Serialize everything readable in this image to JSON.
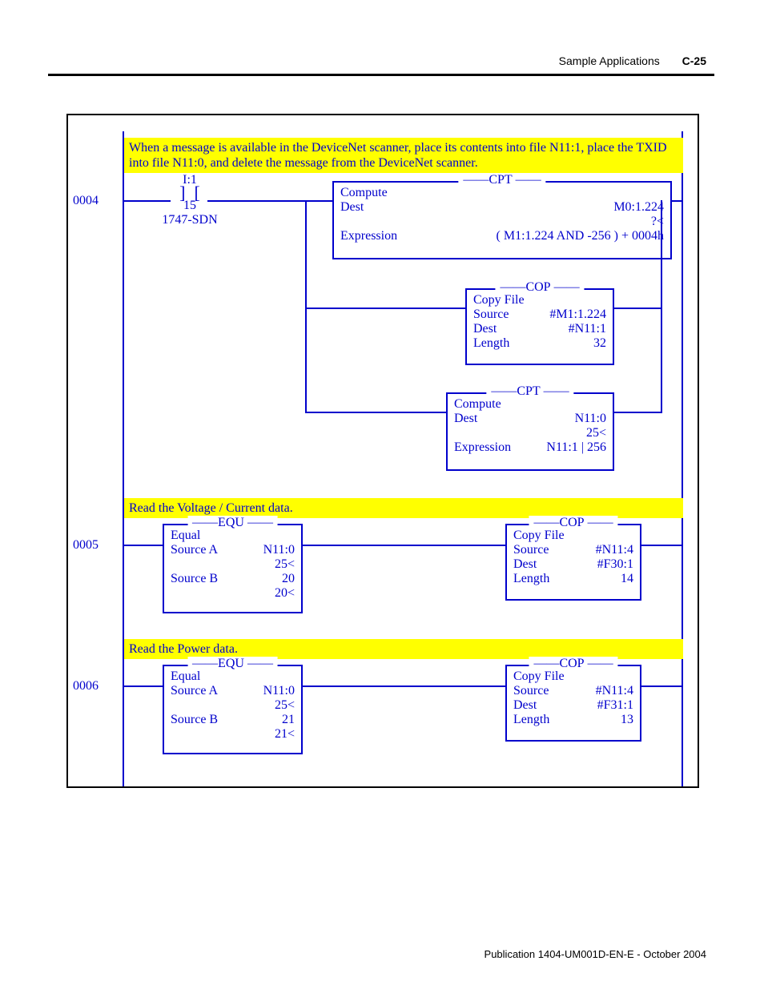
{
  "header": {
    "section": "Sample Applications",
    "pagenum": "C-25"
  },
  "footer": "Publication 1404-UM001D-EN-E - October 2004",
  "rung4": {
    "number": "0004",
    "comment": "When a message is available in the DeviceNet scanner, place its contents into file N11:1, place the TXID into file N11:0, and delete the message from the DeviceNet scanner.",
    "xic": {
      "addr": "I:1",
      "bit": "15",
      "dev": "1747-SDN"
    },
    "cpt1": {
      "code": "CPT",
      "name": "Compute",
      "dest_l": "Dest",
      "dest_v": "M0:1.224",
      "dest_q": "?<",
      "expr_l": "Expression",
      "expr_v": "( M1:1.224 AND -256 ) + 0004h"
    },
    "cop": {
      "code": "COP",
      "name": "Copy File",
      "src_l": "Source",
      "src_v": "#M1:1.224",
      "dest_l": "Dest",
      "dest_v": "#N11:1",
      "len_l": "Length",
      "len_v": "32"
    },
    "cpt2": {
      "code": "CPT",
      "name": "Compute",
      "dest_l": "Dest",
      "dest_v": "N11:0",
      "dest_q": "25<",
      "expr_l": "Expression",
      "expr_v": "N11:1 | 256"
    }
  },
  "rung5": {
    "number": "0005",
    "comment": "Read the Voltage / Current data.",
    "equ": {
      "code": "EQU",
      "name": "Equal",
      "a_l": "Source A",
      "a_v": "N11:0",
      "a_q": "25<",
      "b_l": "Source B",
      "b_v": "20",
      "b_q": "20<"
    },
    "cop": {
      "code": "COP",
      "name": "Copy File",
      "src_l": "Source",
      "src_v": "#N11:4",
      "dest_l": "Dest",
      "dest_v": "#F30:1",
      "len_l": "Length",
      "len_v": "14"
    }
  },
  "rung6": {
    "number": "0006",
    "comment": "Read the Power data.",
    "equ": {
      "code": "EQU",
      "name": "Equal",
      "a_l": "Source A",
      "a_v": "N11:0",
      "a_q": "25<",
      "b_l": "Source B",
      "b_v": "21",
      "b_q": "21<"
    },
    "cop": {
      "code": "COP",
      "name": "Copy File",
      "src_l": "Source",
      "src_v": "#N11:4",
      "dest_l": "Dest",
      "dest_v": "#F31:1",
      "len_l": "Length",
      "len_v": "13"
    }
  }
}
